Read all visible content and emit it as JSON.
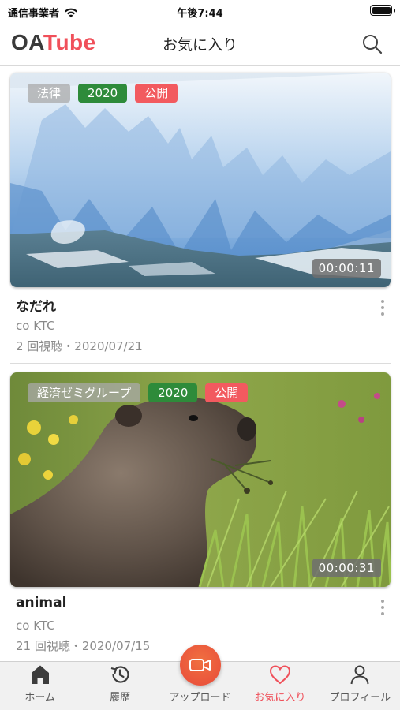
{
  "status_bar": {
    "carrier": "通信事業者",
    "time": "午後7:44"
  },
  "header": {
    "logo_prefix": "OA",
    "logo_suffix": "Tube",
    "title": "お気に入り",
    "search_icon": "search-icon"
  },
  "videos": [
    {
      "category": "法律",
      "year": "2020",
      "visibility": "公開",
      "duration": "00:00:11",
      "title": "なだれ",
      "channel": "co KTC",
      "meta": "2 回視聴・2020/07/21"
    },
    {
      "category": "経済ゼミグループ",
      "year": "2020",
      "visibility": "公開",
      "duration": "00:00:31",
      "title": "animal",
      "channel": "co KTC",
      "meta": "21 回視聴・2020/07/15"
    }
  ],
  "tabs": [
    {
      "label": "ホーム",
      "icon": "home-icon",
      "active": false
    },
    {
      "label": "履歴",
      "icon": "history-icon",
      "active": false
    },
    {
      "label": "アップロード",
      "icon": "video-camera-icon",
      "active": false
    },
    {
      "label": "お気に入り",
      "icon": "heart-icon",
      "active": true
    },
    {
      "label": "プロフィール",
      "icon": "person-icon",
      "active": false
    }
  ],
  "colors": {
    "brand_red": "#f0505a",
    "year_green": "#2e8b3a",
    "upload_orange": "#e84a3a"
  }
}
